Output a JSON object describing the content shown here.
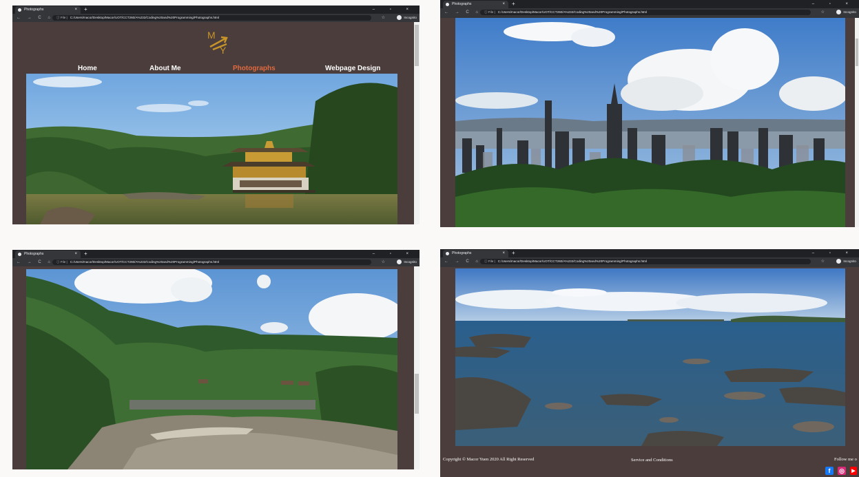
{
  "browser": {
    "tab_title": "Photographs",
    "tab_close": "×",
    "new_tab": "+",
    "window_controls": "–  ▫  ×",
    "nav_buttons": "← → C ⌂",
    "url_label": "ⓘ File |",
    "url": "C:/Users/macor/Desktop/Macor/UOT/CCT260/A%232/Coding%20and%20Programming/Photographs.html",
    "bookmark_star": "☆",
    "incognito": "Incognito"
  },
  "site": {
    "logo_text_top": "M",
    "logo_text_bottom": "Y",
    "nav": [
      {
        "label": "Home",
        "active": false
      },
      {
        "label": "About Me",
        "active": false
      },
      {
        "label": "Photographs",
        "active": true
      },
      {
        "label": "Webpage Design",
        "active": false
      }
    ],
    "footer": {
      "copyright": "Copyright © Macor Yuen 2020 All Right Reserved",
      "service": "Service and Conditions",
      "follow": "Follow me o"
    },
    "social": [
      {
        "name": "facebook-icon",
        "glyph": "f",
        "color": "#1877f2"
      },
      {
        "name": "instagram-icon",
        "glyph": "◎",
        "color": "#d62976"
      },
      {
        "name": "youtube-icon",
        "glyph": "▶",
        "color": "#ff0000"
      }
    ]
  },
  "colors": {
    "page_bg": "#4b3d3b",
    "nav_active": "#e06a3f",
    "nav_default": "#ffffff",
    "logo": "#c7942a"
  }
}
